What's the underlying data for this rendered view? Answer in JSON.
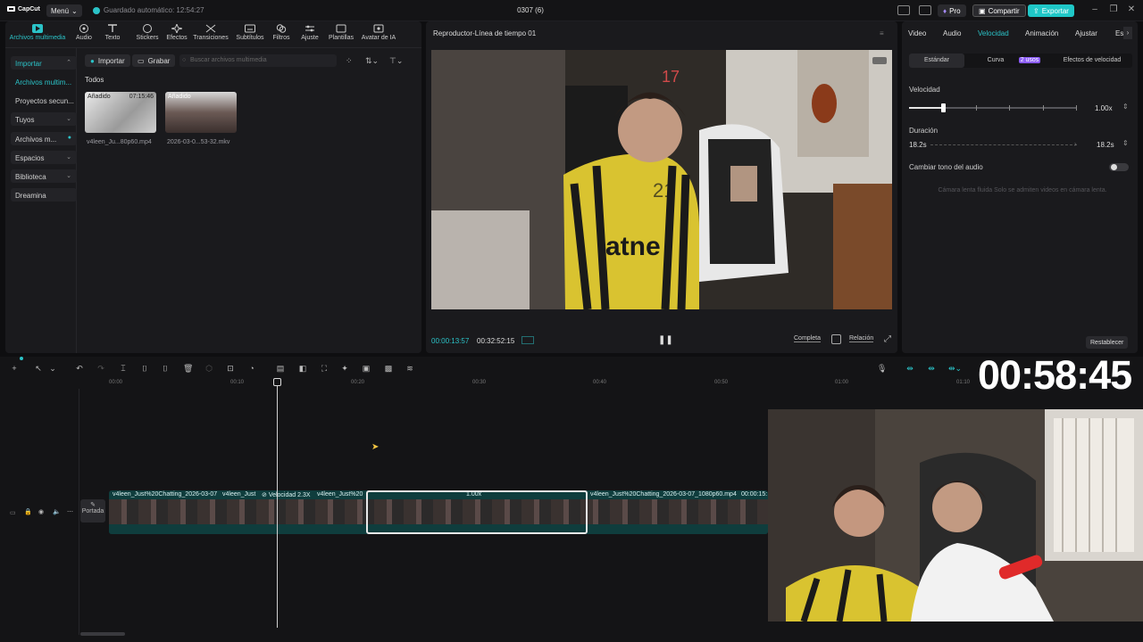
{
  "topbar": {
    "logo": "CapCut",
    "menu": "Menú",
    "autosave": "Guardado automático: 12:54:27",
    "project_title": "0307 (6)",
    "pro": "Pro",
    "share": "Compartir",
    "export": "Exportar"
  },
  "media": {
    "tabs": [
      {
        "label": "Archivos multimedia",
        "icon": "media-icon"
      },
      {
        "label": "Audio",
        "icon": "audio-icon"
      },
      {
        "label": "Texto",
        "icon": "text-icon"
      },
      {
        "label": "Stickers",
        "icon": "sticker-icon"
      },
      {
        "label": "Efectos",
        "icon": "effects-icon"
      },
      {
        "label": "Transiciones",
        "icon": "transitions-icon"
      },
      {
        "label": "Subtítulos",
        "icon": "subtitles-icon"
      },
      {
        "label": "Filtros",
        "icon": "filters-icon"
      },
      {
        "label": "Ajuste",
        "icon": "adjust-icon"
      },
      {
        "label": "Plantillas",
        "icon": "templates-icon"
      },
      {
        "label": "Avatar de IA",
        "icon": "ai-avatar-icon"
      }
    ],
    "sidebar": [
      {
        "label": "Importar"
      },
      {
        "label": "Archivos multim..."
      },
      {
        "label": "Proyectos secun..."
      },
      {
        "label": "Tuyos"
      },
      {
        "label": "Archivos m..."
      },
      {
        "label": "Espacios"
      },
      {
        "label": "Biblioteca"
      },
      {
        "label": "Dreamina"
      }
    ],
    "import_button": "Importar",
    "record_button": "Grabar",
    "search_placeholder": "Buscar archivos multimedia",
    "section": "Todos",
    "items": [
      {
        "badge": "Añadido",
        "duration": "07:15:46",
        "name": "v4leen_Ju...80p60.mp4"
      },
      {
        "badge": "Añadido",
        "duration": "",
        "name": "2026-03-0...53-32.mkv"
      }
    ]
  },
  "player": {
    "title": "Reproductor-Línea de tiempo 01",
    "current_time": "00:00:13:57",
    "total_time": "00:32:52:15",
    "full_label": "Completa",
    "ratio_label": "Relación"
  },
  "props": {
    "tabs": [
      "Video",
      "Audio",
      "Velocidad",
      "Animación",
      "Ajustar",
      "Es"
    ],
    "modes": [
      "Estándar",
      "Curva",
      "Efectos de velocidad"
    ],
    "curve_badge": "2 usos",
    "speed_label": "Velocidad",
    "speed_value": "1.00x",
    "speed_fraction": 0.1,
    "duration_label": "Duración",
    "duration_from": "18.2s",
    "duration_to": "18.2s",
    "pitch_label": "Cambiar tono del audio",
    "hint": "Cámara lenta fluida  Solo se admiten videos en cámara lenta.",
    "reset": "Restablecer"
  },
  "timeline": {
    "ticks": [
      "00:00",
      "00:10",
      "00:20",
      "00:30",
      "00:40",
      "00:50",
      "01:00",
      "01:10"
    ],
    "cover": "Portada",
    "clips": [
      {
        "label": "v4leen_Just%20Chatting_2026-03-07"
      },
      {
        "label": "v4leen_Just"
      },
      {
        "label": "Velocidad 2.3X"
      },
      {
        "label": "v4leen_Just%20"
      },
      {
        "label": "1.00x"
      },
      {
        "label": "v4leen_Just%20Chatting_2026-03-07_1080p60.mp4"
      },
      {
        "label": "00:00:15:"
      }
    ],
    "clock": "00:58:45"
  },
  "video_overlay": {
    "num_top": "17",
    "num_mid": "21",
    "shirt": "atne"
  },
  "colors": {
    "accent": "#2bc3c8",
    "track": "#0f3d3d"
  }
}
